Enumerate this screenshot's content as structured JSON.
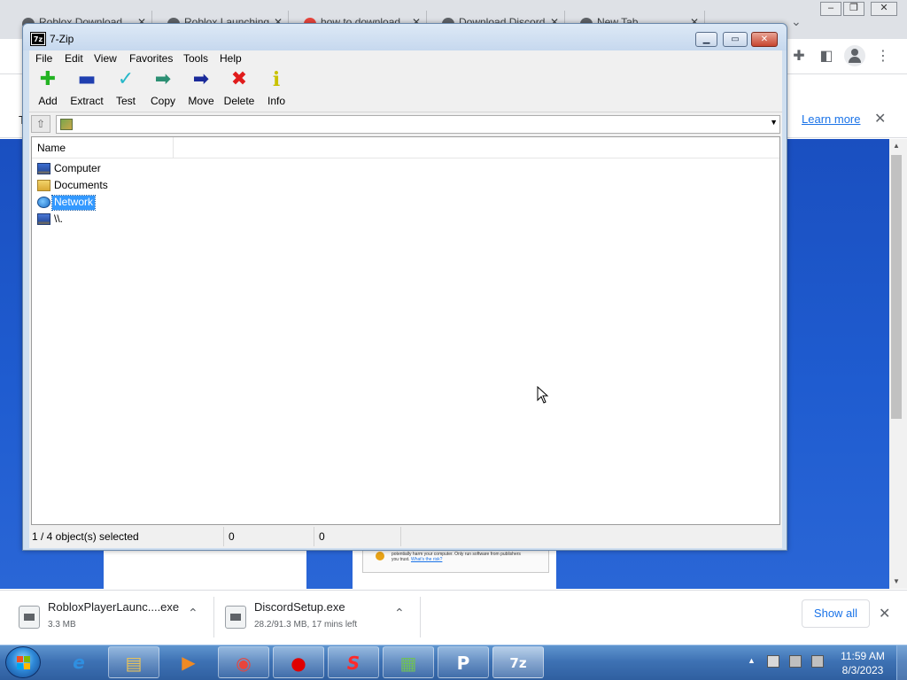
{
  "chrome": {
    "tabs": [
      {
        "label": "Roblox Download"
      },
      {
        "label": "Roblox Launching"
      },
      {
        "label": "how to download"
      },
      {
        "label": "Download Discord"
      },
      {
        "label": "New Tab"
      }
    ],
    "infobar": {
      "prefix": "T",
      "learn_more": "Learn more"
    },
    "content_warning_line1": "potentially harm your computer. Only run software from publishers",
    "content_warning_line2": "you trust.",
    "content_warning_link": "What's the risk?"
  },
  "downloads": {
    "items": [
      {
        "name": "RobloxPlayerLaunc....exe",
        "status": "3.3 MB"
      },
      {
        "name": "DiscordSetup.exe",
        "status": "28.2/91.3 MB, 17 mins left"
      }
    ],
    "show_all": "Show all"
  },
  "zip": {
    "title": "7-Zip",
    "app_icon_text": "7z",
    "menu": [
      "File",
      "Edit",
      "View",
      "Favorites",
      "Tools",
      "Help"
    ],
    "toolbar": [
      {
        "label": "Add",
        "icon": "plus-icon",
        "glyph": "✚",
        "color": "#22b322"
      },
      {
        "label": "Extract",
        "icon": "minus-icon",
        "glyph": "▬",
        "color": "#1f3fb0"
      },
      {
        "label": "Test",
        "icon": "check-icon",
        "glyph": "✓",
        "color": "#27b8c9"
      },
      {
        "label": "Copy",
        "icon": "arrow-right-green-icon",
        "glyph": "➡",
        "color": "#2c8f73"
      },
      {
        "label": "Move",
        "icon": "arrow-right-blue-icon",
        "glyph": "➡",
        "color": "#1a2a9a"
      },
      {
        "label": "Delete",
        "icon": "x-icon",
        "glyph": "✖",
        "color": "#e01b1b"
      },
      {
        "label": "Info",
        "icon": "info-icon",
        "glyph": "i",
        "color": "#c9c200"
      }
    ],
    "address": "",
    "columns": {
      "name": "Name"
    },
    "rows": [
      {
        "label": "Computer",
        "icon": "computer-icon",
        "selected": false
      },
      {
        "label": "Documents",
        "icon": "folder-icon",
        "selected": false
      },
      {
        "label": "Network",
        "icon": "network-icon",
        "selected": true
      },
      {
        "label": "\\\\.",
        "icon": "computer-icon",
        "selected": false
      }
    ],
    "status": {
      "selection": "1 / 4 object(s) selected",
      "size": "0",
      "packed": "0"
    }
  },
  "taskbar": {
    "apps": [
      {
        "name": "internet-explorer-icon",
        "glyph": "e",
        "color": "#2f8fe0"
      },
      {
        "name": "file-explorer-icon",
        "glyph": "▤",
        "color": "#e8c25a"
      },
      {
        "name": "media-player-icon",
        "glyph": "▶",
        "color": "#f08a24"
      },
      {
        "name": "chrome-icon",
        "glyph": "◉",
        "color": "#e8453c"
      },
      {
        "name": "recorder-icon",
        "glyph": "●",
        "color": "#e00000"
      },
      {
        "name": "speed-app-icon",
        "glyph": "S",
        "color": "#ff2a2a"
      },
      {
        "name": "network-monitor-icon",
        "glyph": "▦",
        "color": "#6fbf5a"
      },
      {
        "name": "psiphon-icon",
        "glyph": "P",
        "color": "#ffffff"
      },
      {
        "name": "7zip-taskbar-icon",
        "glyph": "7z",
        "color": "#ffffff"
      }
    ],
    "clock": {
      "time": "11:59 AM",
      "date": "8/3/2023"
    }
  }
}
